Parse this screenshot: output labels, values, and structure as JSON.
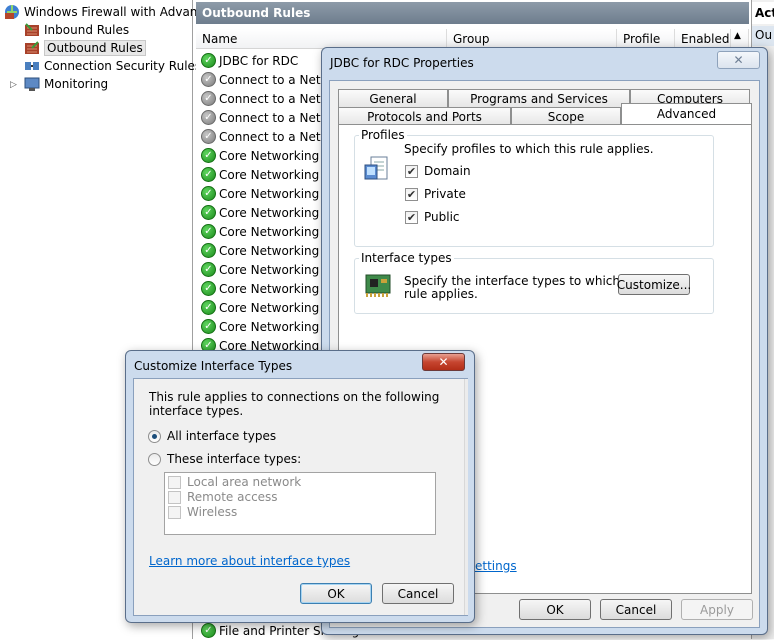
{
  "tree": {
    "root_label": "Windows Firewall with Advance",
    "items": [
      {
        "label": "Inbound Rules"
      },
      {
        "label": "Outbound Rules"
      },
      {
        "label": "Connection Security Rules"
      },
      {
        "label": "Monitoring"
      }
    ]
  },
  "list": {
    "pane_title": "Outbound Rules",
    "columns": [
      "Name",
      "Group",
      "Profile",
      "Enabled"
    ],
    "rows": [
      {
        "name": "JDBC for RDC",
        "status": "on"
      },
      {
        "name": "Connect to a Netwo",
        "status": "off"
      },
      {
        "name": "Connect to a Netwo",
        "status": "off"
      },
      {
        "name": "Connect to a Netwo",
        "status": "off"
      },
      {
        "name": "Connect to a Netwo",
        "status": "off"
      },
      {
        "name": "Core Networking -",
        "status": "on"
      },
      {
        "name": "Core Networking -",
        "status": "on"
      },
      {
        "name": "Core Networking -",
        "status": "on"
      },
      {
        "name": "Core Networking -",
        "status": "on"
      },
      {
        "name": "Core Networking -",
        "status": "on"
      },
      {
        "name": "Core Networking -",
        "status": "on"
      },
      {
        "name": "Core Networking -",
        "status": "on"
      },
      {
        "name": "Core Networking -",
        "status": "on"
      },
      {
        "name": "Core Networking -",
        "status": "on"
      },
      {
        "name": "Core Networking -",
        "status": "on"
      },
      {
        "name": "Core Networking -",
        "status": "on"
      }
    ],
    "bottom_row": {
      "name": "File and Printer Sharing",
      "status": "on"
    }
  },
  "actions": {
    "header": "Act",
    "sub": "Ou"
  },
  "properties": {
    "title": "JDBC for RDC Properties",
    "tabs_row1": [
      "General",
      "Programs and Services",
      "Computers"
    ],
    "tabs_row2": [
      "Protocols and Ports",
      "Scope",
      "Advanced"
    ],
    "profiles": {
      "label": "Profiles",
      "description": "Specify profiles to which this rule applies.",
      "options": [
        {
          "label": "Domain",
          "checked": true
        },
        {
          "label": "Private",
          "checked": true
        },
        {
          "label": "Public",
          "checked": true
        }
      ]
    },
    "interface_types": {
      "label": "Interface types",
      "description_line1": "Specify the interface types to which this",
      "description_line2": "rule applies.",
      "customize_label": "Customize..."
    },
    "partial_link": "ettings",
    "ok_label": "OK",
    "cancel_label": "Cancel",
    "apply_label": "Apply"
  },
  "customize": {
    "title": "Customize Interface Types",
    "intro": "This rule applies to connections on the following interface types.",
    "all_label": "All interface types",
    "these_label": "These interface types:",
    "selected": "all",
    "options": [
      {
        "label": "Local area network"
      },
      {
        "label": "Remote access"
      },
      {
        "label": "Wireless"
      }
    ],
    "learn_more": "Learn more about interface types",
    "ok_label": "OK",
    "cancel_label": "Cancel"
  }
}
